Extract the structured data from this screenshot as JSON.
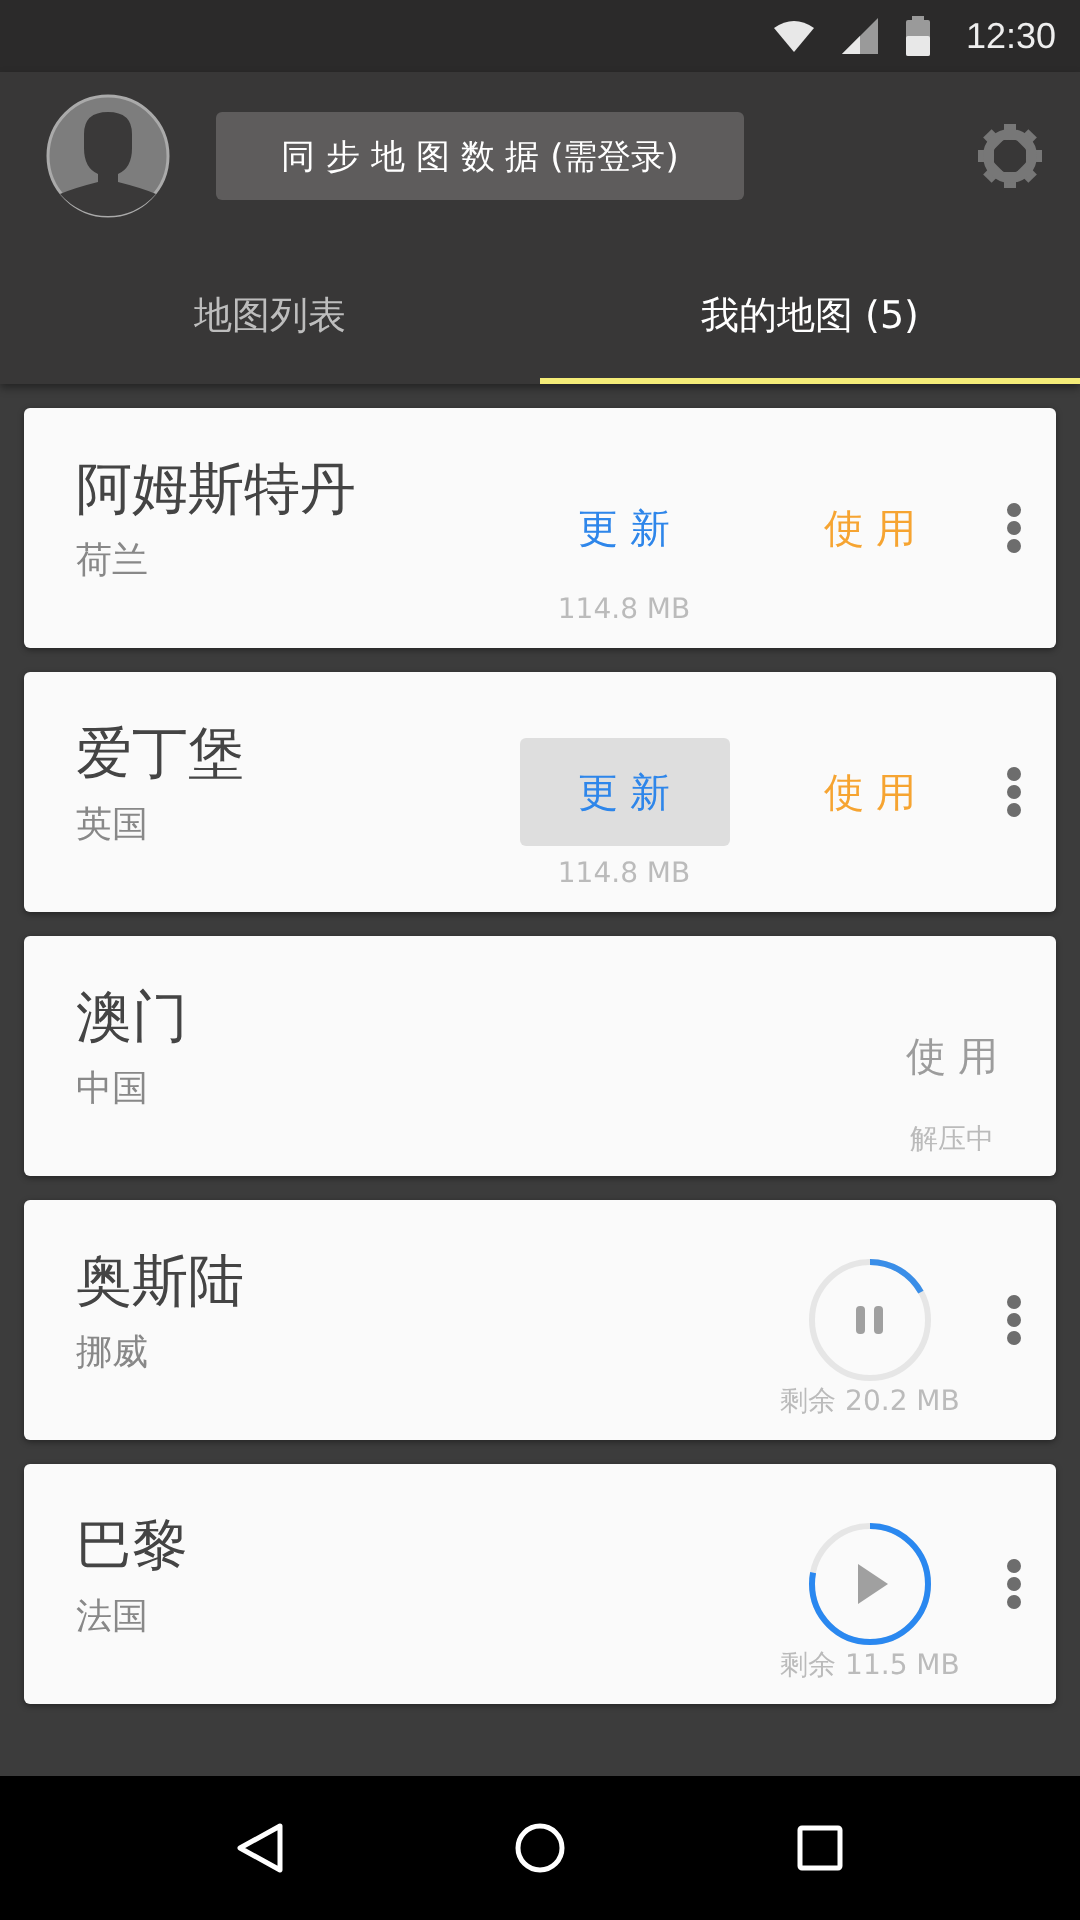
{
  "status_bar": {
    "time": "12:30"
  },
  "header": {
    "sync_button": "同 步 地 图 数 据 (需登录)"
  },
  "tabs": [
    {
      "label": "地图列表",
      "selected": false
    },
    {
      "label": "我的地图 (5)",
      "selected": true
    }
  ],
  "maps": [
    {
      "kind": "installed",
      "name": "阿姆斯特丹",
      "country": "荷兰",
      "update_button": "更 新",
      "update_pressed": false,
      "use_button": "使 用",
      "size": "114.8 MB"
    },
    {
      "kind": "installed",
      "name": "爱丁堡",
      "country": "英国",
      "update_button": "更 新",
      "update_pressed": true,
      "use_button": "使 用",
      "size": "114.8 MB"
    },
    {
      "kind": "unpacking",
      "name": "澳门",
      "country": "中国",
      "use_button": "使 用",
      "status": "解压中"
    },
    {
      "kind": "downloading",
      "name": "奥斯陆",
      "country": "挪威",
      "paused": false,
      "level": 0.17,
      "remaining": "剩余 20.2 MB"
    },
    {
      "kind": "downloading",
      "name": "巴黎",
      "country": "法国",
      "paused": true,
      "level": 0.78,
      "remaining": "剩余 11.5 MB"
    }
  ]
}
